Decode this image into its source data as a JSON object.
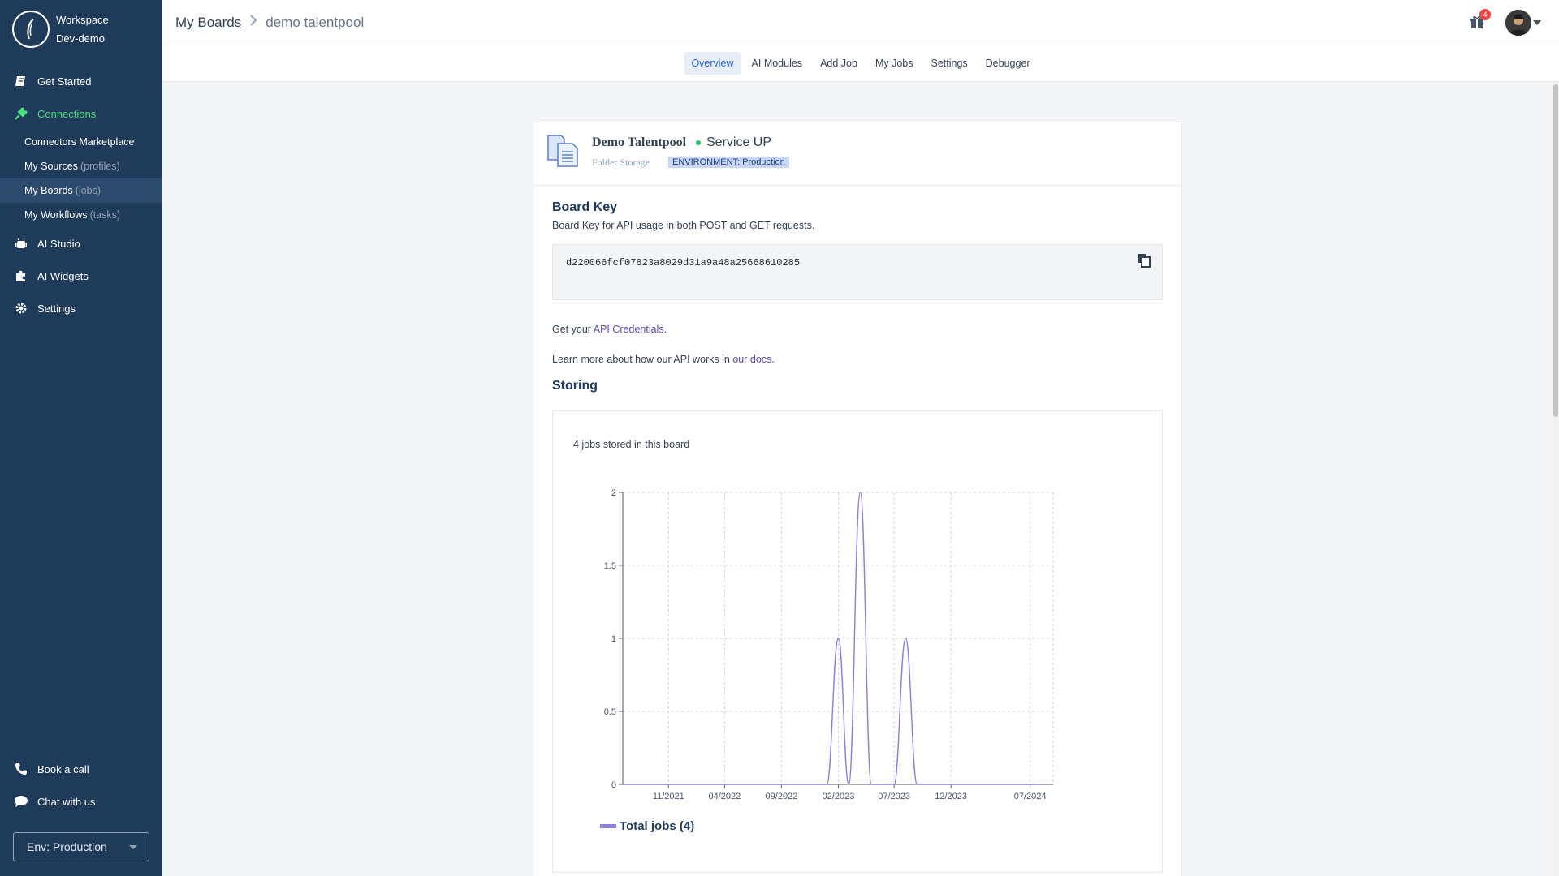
{
  "workspace": {
    "line1": "Workspace",
    "line2": "Dev-demo"
  },
  "sidebar": {
    "get_started": "Get Started",
    "connections": "Connections",
    "sub_items": [
      {
        "label": "Connectors Marketplace",
        "muted": ""
      },
      {
        "label": "My Sources",
        "muted": "(profiles)"
      },
      {
        "label": "My Boards",
        "muted": "(jobs)"
      },
      {
        "label": "My Workflows",
        "muted": "(tasks)"
      }
    ],
    "ai_studio": "AI Studio",
    "ai_widgets": "AI Widgets",
    "settings": "Settings",
    "book_call": "Book a call",
    "chat": "Chat with us",
    "env_select": "Env: Production"
  },
  "header": {
    "breadcrumb_root": "My Boards",
    "breadcrumb_current": "demo talentpool",
    "notification_count": "4"
  },
  "tabs": [
    "Overview",
    "AI Modules",
    "Add Job",
    "My Jobs",
    "Settings",
    "Debugger"
  ],
  "board": {
    "name": "Demo Talentpool",
    "service_status": "Service UP",
    "storage_type": "Folder Storage",
    "environment": "ENVIRONMENT: Production",
    "key_title": "Board Key",
    "key_desc": "Board Key for API usage in both POST and GET requests.",
    "key_value": "d220066fcf07823a8029d31a9a48a25668610285",
    "credentials_prefix": "Get your ",
    "credentials_link": "API Credentials",
    "credentials_suffix": ".",
    "docs_prefix": "Learn more about how our API works in ",
    "docs_link": "our docs",
    "docs_suffix": ".",
    "storing_title": "Storing",
    "jobs_summary": "4 jobs stored in this board"
  },
  "colors": {
    "sidebar_bg": "#1f3b5a",
    "accent": "#4ade80",
    "link": "#5b4bbd",
    "series": "#8b7fd6"
  },
  "chart_data": {
    "type": "line",
    "xlabel": "",
    "ylabel": "",
    "x_ticks": [
      "11/2021",
      "04/2022",
      "09/2022",
      "02/2023",
      "07/2023",
      "12/2023",
      "07/2024"
    ],
    "y_ticks": [
      "0",
      "0.5",
      "1",
      "1.5",
      "2"
    ],
    "ylim": [
      0,
      2
    ],
    "grid": true,
    "legend_position": "bottom-left",
    "series": [
      {
        "name": "Total jobs (4)",
        "x": [
          "2021-07",
          "2021-11",
          "2022-04",
          "2022-09",
          "2023-01",
          "2023-02",
          "2023-03",
          "2023-04",
          "2023-05",
          "2023-06",
          "2023-07",
          "2023-08",
          "2023-09",
          "2023-10",
          "2023-12",
          "2024-07",
          "2024-08"
        ],
        "values": [
          0,
          0,
          0,
          0,
          0,
          1,
          0,
          2,
          0,
          0,
          0,
          1,
          0,
          0,
          0,
          0,
          0
        ]
      }
    ]
  }
}
